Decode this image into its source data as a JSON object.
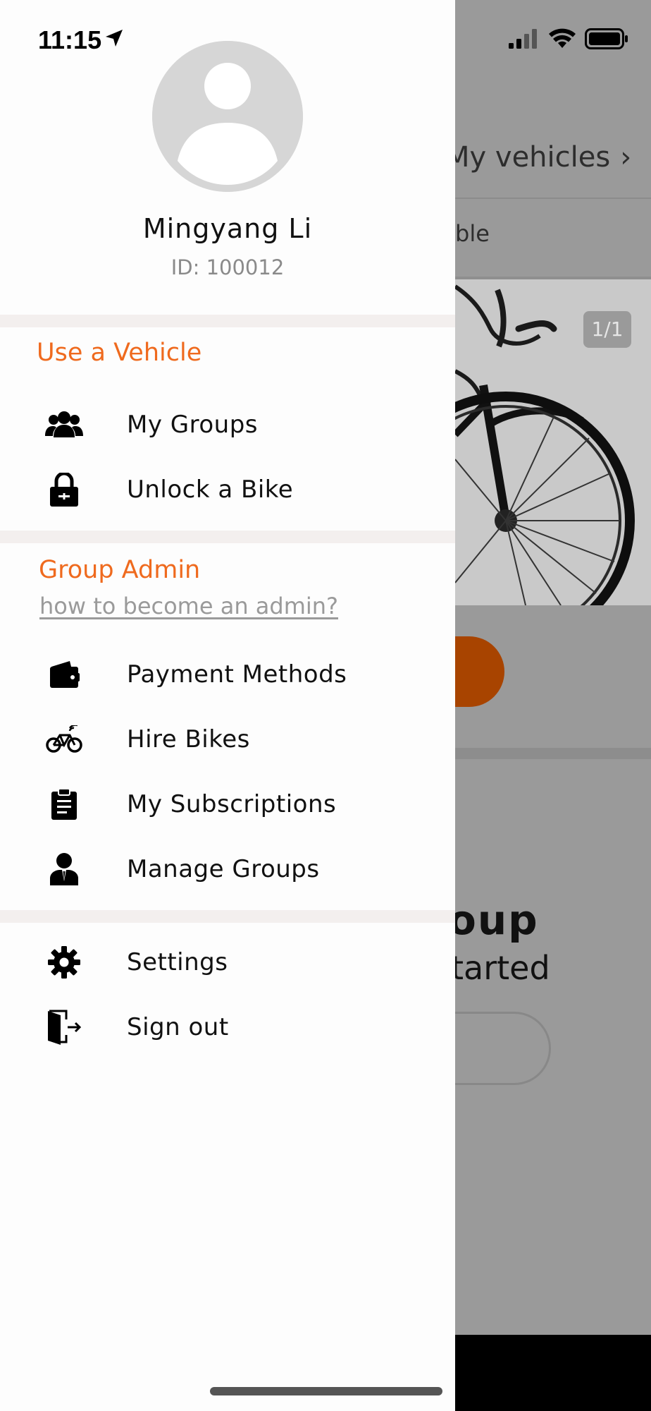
{
  "status_bar": {
    "time": "11:15"
  },
  "background": {
    "my_vehicles_label": "My vehicles",
    "available_label": "ble",
    "photo_counter": "1/1",
    "group_heading": "oup",
    "started_text": "tarted"
  },
  "drawer": {
    "user": {
      "name": "Mingyang Li",
      "id_text": "ID: 100012"
    },
    "use_vehicle": {
      "title": "Use a Vehicle",
      "items": [
        {
          "label": "My Groups",
          "icon": "group-icon"
        },
        {
          "label": "Unlock a Bike",
          "icon": "lock-icon"
        }
      ]
    },
    "group_admin": {
      "title": "Group Admin",
      "help_link": "how to become an admin?",
      "items": [
        {
          "label": "Payment Methods",
          "icon": "wallet-icon"
        },
        {
          "label": "Hire Bikes",
          "icon": "bike-icon"
        },
        {
          "label": "My Subscriptions",
          "icon": "clipboard-icon"
        },
        {
          "label": "Manage Groups",
          "icon": "admin-user-icon"
        }
      ]
    },
    "other": {
      "items": [
        {
          "label": "Settings",
          "icon": "gear-icon"
        },
        {
          "label": "Sign out",
          "icon": "sign-out-icon"
        }
      ]
    }
  },
  "colors": {
    "accent": "#ef6a1e",
    "dim_overlay": "#9a9a9a",
    "primary_button": "#a84400"
  }
}
